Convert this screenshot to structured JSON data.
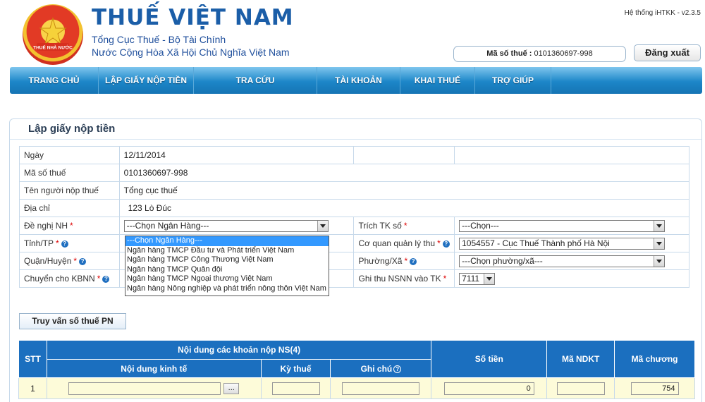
{
  "header": {
    "brand_title": "THUẾ VIỆT NAM",
    "brand_sub1": "Tổng Cục Thuế - Bộ Tài Chính",
    "brand_sub2": "Nước Cộng Hòa Xã Hội Chủ Nghĩa Việt Nam",
    "logo_text": "THUẾ NHÀ NƯỚC",
    "system_version": "Hệ thống iHTKK - v2.3.5",
    "tax_code_label": "Mã số thuế :",
    "tax_code_value": "0101360697-998",
    "logout_label": "Đăng xuất"
  },
  "nav": {
    "items": [
      {
        "label": "TRANG CHỦ"
      },
      {
        "label": "LẬP GIẤY NỘP TIỀN"
      },
      {
        "label": "TRA CỨU"
      },
      {
        "label": "TÀI KHOẢN"
      },
      {
        "label": "KHAI THUẾ"
      },
      {
        "label": "TRỢ GIÚP"
      }
    ]
  },
  "page": {
    "title": "Lập giấy nộp tiền"
  },
  "form": {
    "date_label": "Ngày",
    "date_value": "12/11/2014",
    "taxcode_label": "Mã số thuế",
    "taxcode_value": "0101360697-998",
    "payer_label": "Tên người nộp thuế",
    "payer_value": "Tổng cục thuế",
    "address_label": "Địa chỉ",
    "address_value": "123 Lò Đúc",
    "bank_label": "Đề nghị NH",
    "bank_value": "---Chọn Ngân Hàng---",
    "debit_label": "Trích TK số",
    "debit_value": "---Chọn---",
    "province_label": "Tỉnh/TP",
    "agency_label": "Cơ quan quản lý thu",
    "agency_value": "1054557 - Cục Thuế Thành phố Hà Nội",
    "district_label": "Quận/Huyện",
    "ward_label": "Phường/Xã",
    "ward_value": "---Chọn phường/xã---",
    "treasury_label": "Chuyển cho KBNN",
    "account_label": "Ghi thu NSNN vào TK",
    "account_value": "7111",
    "required_mark": "*",
    "hint_mark": "?"
  },
  "bank_dropdown": {
    "options": [
      "---Chọn Ngân Hàng---",
      "Ngân hàng TMCP Đầu tư và Phát triển Việt Nam",
      "Ngân hàng TMCP Công Thương Việt Nam",
      "Ngân hàng TMCP Quân đội",
      "Ngân hàng TMCP Ngoại thương Việt Nam",
      "Ngân hàng Nông nghiệp và phát triển nông thôn Việt Nam"
    ],
    "selected_index": 0
  },
  "query_button": "Truy vấn số thuế PN",
  "grid": {
    "headers": {
      "stt": "STT",
      "group": "Nội dung các khoản nộp NS(4)",
      "content": "Nội dung kinh tế",
      "period": "Kỳ thuế",
      "note": "Ghi chú",
      "amount": "Số tiền",
      "ndkt": "Mã NDKT",
      "chapter": "Mã chương"
    },
    "rows": [
      {
        "stt": "1",
        "amount": "0",
        "chapter": "754",
        "browse": "..."
      }
    ]
  },
  "colors": {
    "nav_bg": "#1c86c8",
    "grid_header_bg": "#1b6fbf",
    "brand_blue": "#1b5ea8",
    "dropdown_highlight": "#3399ff",
    "input_bg": "#fdfbd9"
  }
}
